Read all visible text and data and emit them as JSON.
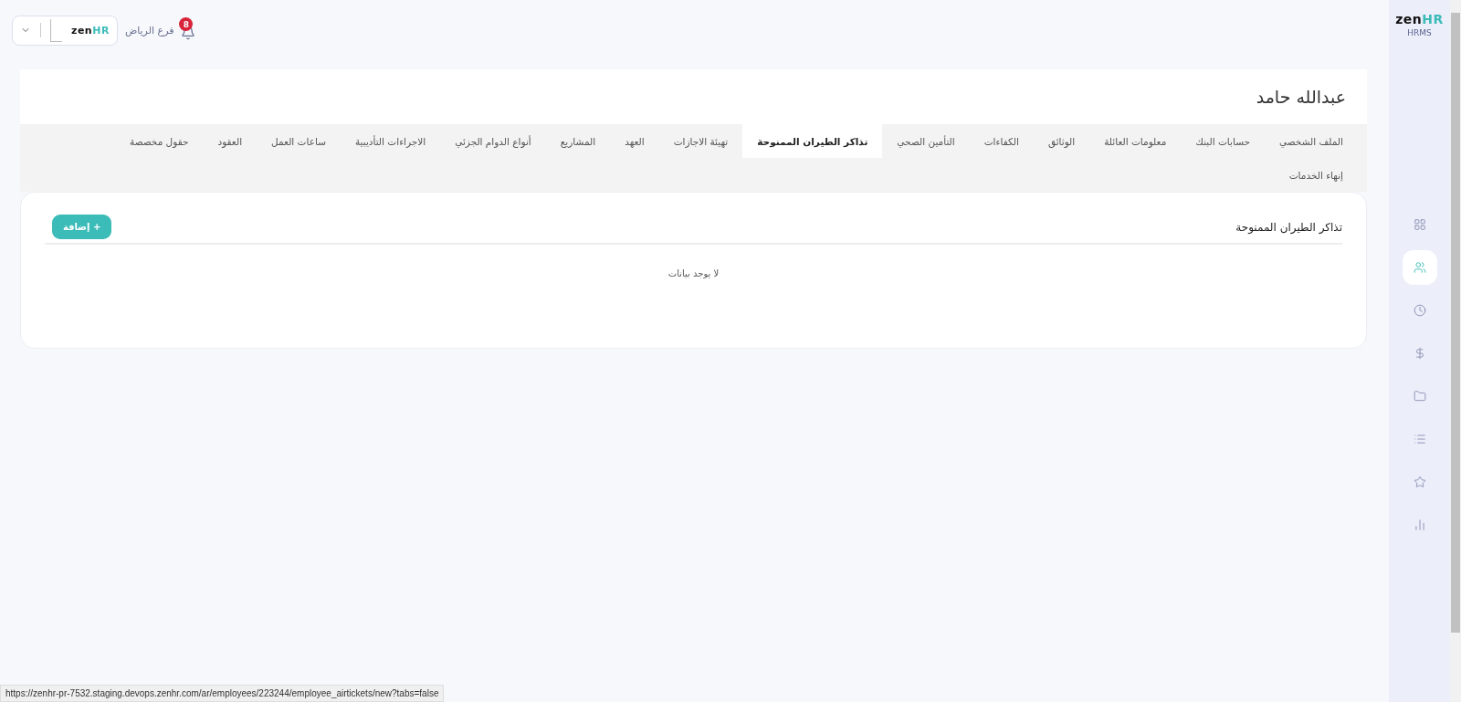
{
  "top_bar": {
    "company_logo": {
      "prefix": "zen",
      "suffix": "HR"
    },
    "branch": "فرع الرياض",
    "notifications": {
      "count": "8"
    }
  },
  "sidebar": {
    "logo": {
      "prefix": "zen",
      "suffix": "HR"
    },
    "subtitle": "HRMS",
    "items": [
      {
        "kind": "grid",
        "selected": false
      },
      {
        "kind": "users",
        "selected": true
      },
      {
        "kind": "clock",
        "selected": false
      },
      {
        "kind": "dollar",
        "selected": false
      },
      {
        "kind": "folder",
        "selected": false
      },
      {
        "kind": "list",
        "selected": false
      },
      {
        "kind": "star",
        "selected": false
      },
      {
        "kind": "chart",
        "selected": false
      }
    ]
  },
  "employee": {
    "name": "عبدالله حامد"
  },
  "tabs": [
    {
      "label": "الملف الشخصي",
      "selected": false
    },
    {
      "label": "حسابات البنك",
      "selected": false
    },
    {
      "label": "معلومات العائلة",
      "selected": false
    },
    {
      "label": "الوثائق",
      "selected": false
    },
    {
      "label": "الكفاءات",
      "selected": false
    },
    {
      "label": "التأمين الصحي",
      "selected": false
    },
    {
      "label": "تذاكر الطيران الممنوحة",
      "selected": true
    },
    {
      "label": "تهيئة الاجازات",
      "selected": false
    },
    {
      "label": "العهد",
      "selected": false
    },
    {
      "label": "المشاريع",
      "selected": false
    },
    {
      "label": "أنواع الدوام الجزئي",
      "selected": false
    },
    {
      "label": "الاجراءات التأديبية",
      "selected": false
    },
    {
      "label": "ساعات العمل",
      "selected": false
    },
    {
      "label": "العقود",
      "selected": false
    },
    {
      "label": "حقول مخصصة",
      "selected": false
    },
    {
      "label": "إنهاء الخدمات",
      "selected": false
    }
  ],
  "section": {
    "title": "تذاكر الطيران الممنوحة",
    "add_button": "+ إضافة",
    "empty_message": "لا يوجد بيانات"
  },
  "status_bar": {
    "url": "https://zenhr-pr-7532.staging.devops.zenhr.com/ar/employees/223244/employee_airtickets/new?tabs=false"
  }
}
